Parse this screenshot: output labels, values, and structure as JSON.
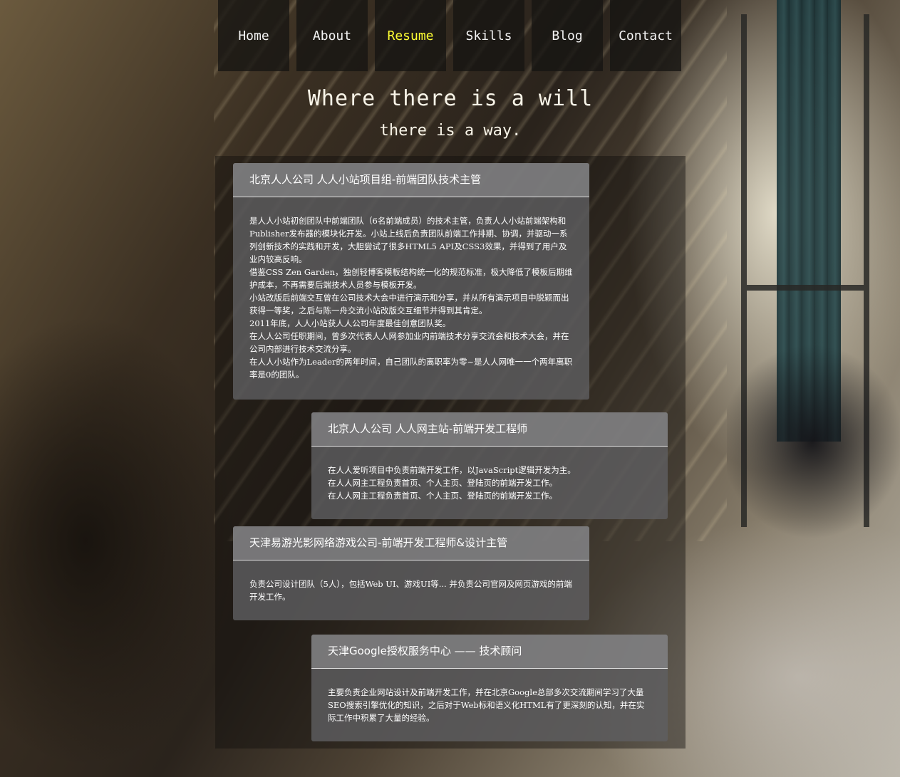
{
  "nav": {
    "items": [
      {
        "label": "Home",
        "active": false
      },
      {
        "label": "About",
        "active": false
      },
      {
        "label": "Resume",
        "active": true
      },
      {
        "label": "Skills",
        "active": false
      },
      {
        "label": "Blog",
        "active": false
      },
      {
        "label": "Contact",
        "active": false
      }
    ],
    "active_color": "#ffff33"
  },
  "headline": {
    "line1": "Where there is a will",
    "line2": "there is a way."
  },
  "resume": [
    {
      "title": "北京人人公司 人人小站项目组-前端团队技术主管",
      "paragraphs": [
        "是人人小站初创团队中前端团队（6名前端成员）的技术主管，负责人人小站前端架构和Publisher发布器的模块化开发。小站上线后负责团队前端工作排期、协调，并驱动一系列创新技术的实践和开发，大胆尝试了很多HTML5 API及CSS3效果，并得到了用户及业内较高反响。",
        "借鉴CSS Zen Garden，独创轻博客模板结构统一化的规范标准，极大降低了模板后期维护成本，不再需要后端技术人员参与模板开发。",
        "小站改版后前端交互曾在公司技术大会中进行演示和分享，并从所有演示项目中脱颖而出获得一等奖，之后与陈一舟交流小站改版交互细节并得到其肯定。",
        "2011年底，人人小站获人人公司年度最佳创意团队奖。",
        "在人人公司任职期间，曾多次代表人人网参加业内前端技术分享交流会和技术大会，并在公司内部进行技术交流分享。",
        "在人人小站作为Leader的两年时间，自己团队的离职率为零~是人人网唯一一个两年离职率是0的团队。"
      ]
    },
    {
      "title": "北京人人公司 人人网主站-前端开发工程师",
      "paragraphs": [
        "在人人爱听项目中负责前端开发工作，以JavaScript逻辑开发为主。",
        "在人人网主工程负责首页、个人主页、登陆页的前端开发工作。",
        "在人人网主工程负责首页、个人主页、登陆页的前端开发工作。"
      ]
    },
    {
      "title": "天津易游光影网络游戏公司-前端开发工程师&设计主管",
      "paragraphs": [
        "负责公司设计团队（5人），包括Web UI、游戏UI等... 并负责公司官网及网页游戏的前端开发工作。"
      ]
    },
    {
      "title": "天津Google授权服务中心 —— 技术顾问",
      "paragraphs": [
        "主要负责企业网站设计及前端开发工作，并在北京Google总部多次交流期间学习了大量SEO搜索引擎优化的知识，之后对于Web标和语义化HTML有了更深刻的认知，并在实际工作中积累了大量的经验。"
      ]
    }
  ]
}
